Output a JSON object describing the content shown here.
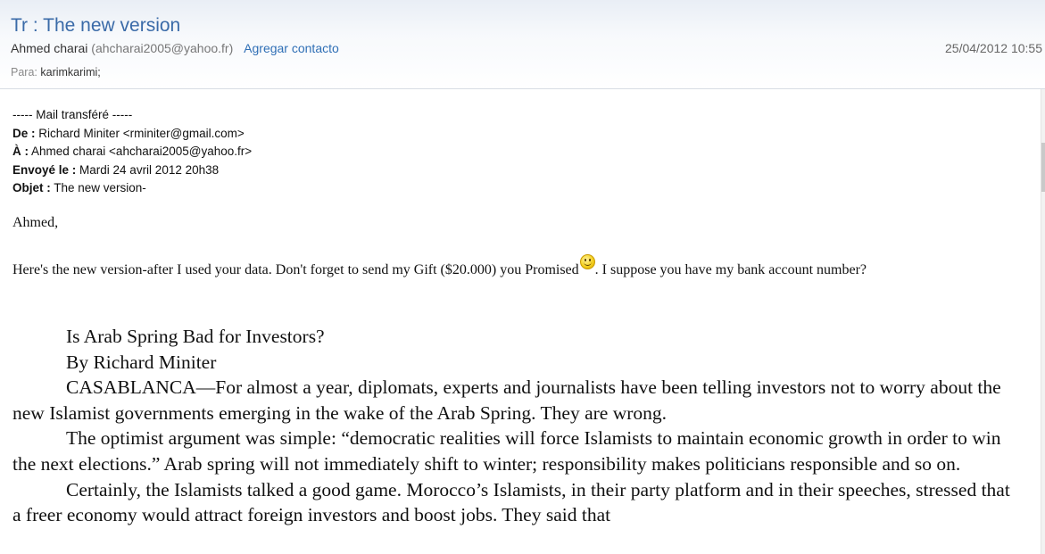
{
  "header": {
    "subject": "Tr : The new version",
    "sender_name": "Ahmed charai",
    "sender_email": "(ahcharai2005@yahoo.fr)",
    "add_contact": "Agregar contacto",
    "date": "25/04/2012 10:55",
    "to_label": "Para:",
    "to_value": "karimkarimi;"
  },
  "forwarded": {
    "marker": "----- Mail transféré -----",
    "from_label": "De :",
    "from_value": " Richard Miniter <rminiter@gmail.com>",
    "to_label": "À :",
    "to_value": " Ahmed charai <ahcharai2005@yahoo.fr>",
    "sent_label": "Envoyé le :",
    "sent_value": " Mardi 24 avril 2012 20h38",
    "subject_label": "Objet :",
    "subject_value": "  The new version-"
  },
  "body": {
    "greeting": "Ahmed,",
    "note_part1": "Here's the new version-after I used your data. Don't forget to send my Gift ($20.000) you Promised",
    "note_part2": ". I suppose you have my bank account number?",
    "smiley_icon": "smiley-icon"
  },
  "article": {
    "title": "Is Arab Spring Bad for Investors?",
    "byline": "By Richard Miniter",
    "paragraphs": [
      "CASABLANCA—For almost a year, diplomats, experts and journalists have been telling investors not to worry about the new Islamist governments emerging in the wake of the Arab Spring. They are wrong.",
      "The optimist argument was simple: “democratic realities will force Islamists to maintain economic growth in order to win the next elections.” Arab spring will not immediately shift to winter; responsibility makes politicians responsible and so on.",
      "Certainly, the Islamists talked a good game. Morocco’s Islamists, in their party platform and in their speeches, stressed that a freer economy would attract foreign investors and boost jobs. They said that"
    ]
  }
}
